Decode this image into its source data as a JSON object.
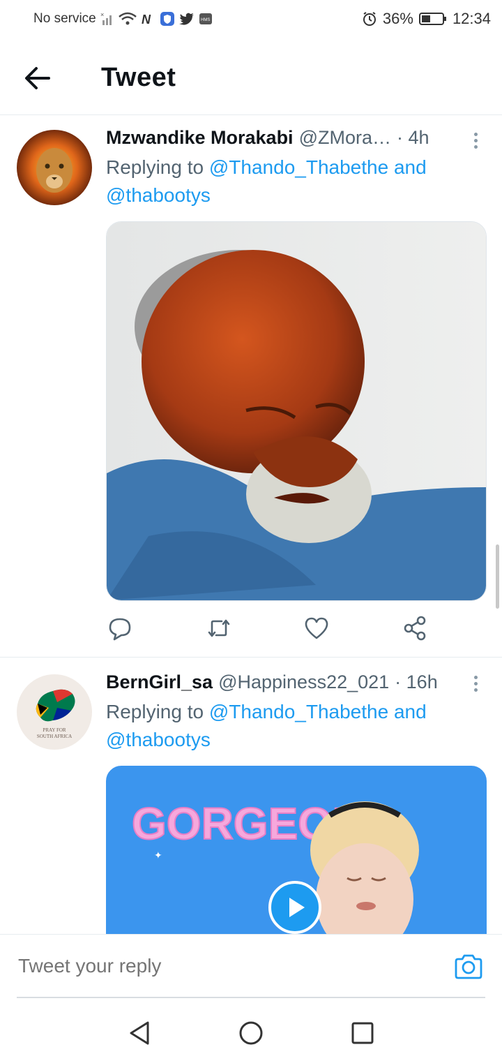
{
  "status_bar": {
    "carrier": "No service",
    "battery": "36%",
    "time": "12:34"
  },
  "header": {
    "title": "Tweet"
  },
  "tweets": [
    {
      "name": "Mzwandike Morakabi",
      "handle": "@ZMora…",
      "time": "· 4h",
      "replying_prefix": "Replying to",
      "mention_1": "@Thando_Thabethe",
      "and": "and",
      "mention_2": "@thabootys",
      "avatar": "lion-avatar",
      "media": "photo-elderly-man-grimacing"
    },
    {
      "name": "BernGirl_sa",
      "handle": "@Happiness22_021",
      "time": "· 16h",
      "replying_prefix": "Replying to",
      "mention_1": "@Thando_Thabethe",
      "and": "and",
      "mention_2": "@thabootys",
      "avatar": "pray-for-south-africa-avatar",
      "avatar_text_1": "PRAY FOR",
      "avatar_text_2": "SOUTH AFRICA",
      "media": "gif-gorgeous",
      "media_text": "GORGEOUS"
    }
  ],
  "reply_bar": {
    "placeholder": "Tweet your reply"
  },
  "colors": {
    "accent": "#1d9bf0",
    "text": "#0f1419",
    "secondary": "#536471"
  }
}
